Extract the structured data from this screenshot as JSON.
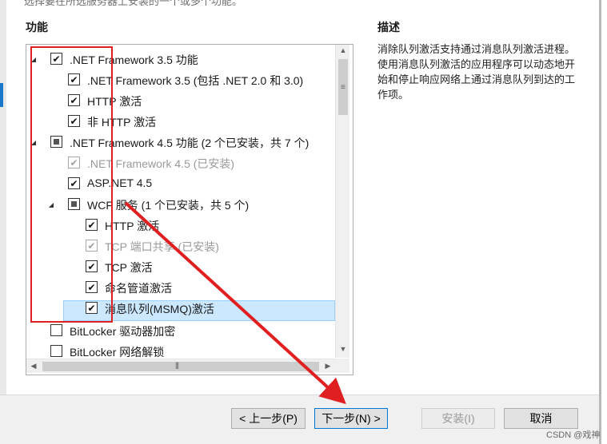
{
  "window": {
    "top_cut_text": "选择要在所选服务器上安装的一个或多个功能。"
  },
  "features_label": "功能",
  "description": {
    "label": "描述",
    "text": "消除队列激活支持通过消息队列激活进程。使用消息队列激活的应用程序可以动态地开始和停止响应网络上通过消息队列到达的工作项。"
  },
  "tree": [
    {
      "label": ".NET Framework 3.5 功能",
      "state": "checked",
      "expander": "expanded",
      "disabled": false
    },
    {
      "label": ".NET Framework 3.5 (包括 .NET 2.0 和 3.0)",
      "state": "checked",
      "disabled": false
    },
    {
      "label": "HTTP 激活",
      "state": "checked",
      "disabled": false
    },
    {
      "label": "非 HTTP 激活",
      "state": "checked",
      "disabled": false
    },
    {
      "label": ".NET Framework 4.5 功能 (2 个已安装，共 7 个)",
      "state": "partial",
      "expander": "expanded",
      "disabled": false
    },
    {
      "label": ".NET Framework 4.5 (已安装)",
      "state": "checked",
      "disabled": true
    },
    {
      "label": "ASP.NET 4.5",
      "state": "checked",
      "disabled": false
    },
    {
      "label": "WCF 服务 (1 个已安装，共 5 个)",
      "state": "partial",
      "expander": "expanded",
      "disabled": false
    },
    {
      "label": "HTTP 激活",
      "state": "checked",
      "disabled": false
    },
    {
      "label": "TCP 端口共享 (已安装)",
      "state": "checked",
      "disabled": true
    },
    {
      "label": "TCP 激活",
      "state": "checked",
      "disabled": false
    },
    {
      "label": "命名管道激活",
      "state": "checked",
      "disabled": false
    },
    {
      "label": "消息队列(MSMQ)激活",
      "state": "checked",
      "disabled": false,
      "selected": true
    },
    {
      "label": "BitLocker 驱动器加密",
      "state": "unchecked",
      "disabled": false
    },
    {
      "label": "BitLocker 网络解锁",
      "state": "unchecked",
      "disabled": false
    }
  ],
  "buttons": {
    "previous": "< 上一步(P)",
    "next": "下一步(N) >",
    "install": "安装(I)",
    "cancel": "取消"
  },
  "watermark": "CSDN @戏神",
  "colors": {
    "annotation_red": "#e02020",
    "selection": "#cce8ff",
    "accent": "#1979ca"
  }
}
